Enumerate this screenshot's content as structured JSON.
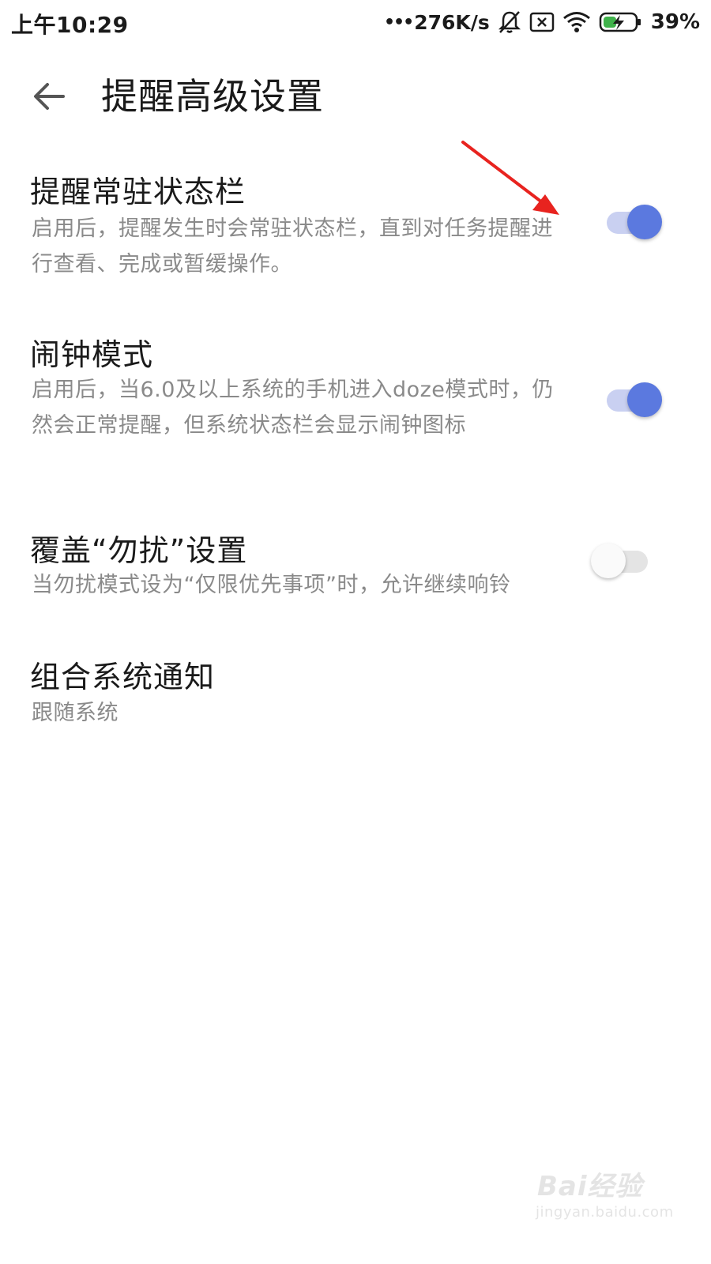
{
  "status_bar": {
    "time": "上午10:29",
    "net_speed": "276K/s",
    "battery_percent": "39%",
    "icons": [
      "more-dots-icon",
      "bell-off-icon",
      "sim-x-icon",
      "wifi-icon",
      "battery-charging-icon"
    ]
  },
  "header": {
    "back_icon": "back-arrow-icon",
    "title": "提醒高级设置"
  },
  "settings": [
    {
      "title": "提醒常驻状态栏",
      "description": "启用后，提醒发生时会常驻状态栏，直到对任务提醒进行查看、完成或暂缓操作。",
      "toggle": "on"
    },
    {
      "title": "闹钟模式",
      "description": "启用后，当6.0及以上系统的手机进入doze模式时，仍然会正常提醒，但系统状态栏会显示闹钟图标",
      "toggle": "on"
    },
    {
      "title": "覆盖“勿扰”设置",
      "description": "当勿扰模式设为“仅限优先事项”时，允许继续响铃",
      "toggle": "off"
    },
    {
      "title": "组合系统通知",
      "description": "跟随系统"
    }
  ],
  "annotation": {
    "type": "red-arrow",
    "color": "#e8231f"
  },
  "watermark": {
    "brand": "Bai经验",
    "url": "jingyan.baidu.com"
  },
  "colors": {
    "accent": "#5b79df",
    "accent_track": "#c9d0f1",
    "title_text": "#1a1a1a",
    "secondary_text": "#8a8a8a"
  }
}
